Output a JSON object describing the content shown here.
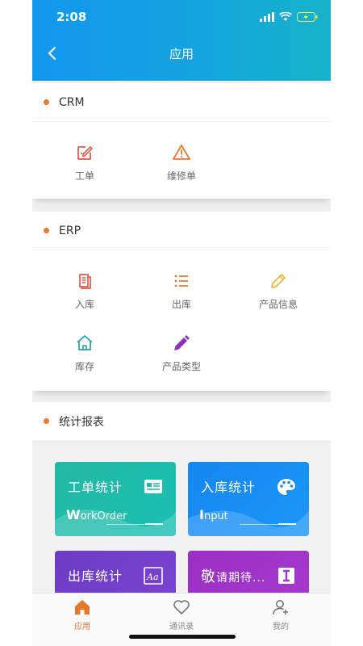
{
  "status": {
    "time": "2:08"
  },
  "header": {
    "title": "应用"
  },
  "sections": {
    "crm": {
      "title": "CRM",
      "items": [
        {
          "label": "工单"
        },
        {
          "label": "维修单"
        }
      ]
    },
    "erp": {
      "title": "ERP",
      "items": [
        {
          "label": "入库"
        },
        {
          "label": "出库"
        },
        {
          "label": "产品信息"
        },
        {
          "label": "库存"
        },
        {
          "label": "产品类型"
        }
      ]
    },
    "reports": {
      "title": "统计报表"
    }
  },
  "cards": [
    {
      "title": "工单统计",
      "sub_initial": "W",
      "sub_rest": "orkOrder"
    },
    {
      "title": "入库统计",
      "sub_initial": "I",
      "sub_rest": "nput"
    },
    {
      "title": "出库统计"
    },
    {
      "title_initial": "敬",
      "title_rest": "请期待..."
    }
  ],
  "tabs": [
    {
      "label": "应用"
    },
    {
      "label": "通讯录"
    },
    {
      "label": "我的"
    }
  ],
  "colors": {
    "accent": "#e87b2c",
    "header_start": "#1296ee",
    "header_end": "#17b3c8",
    "crm_icon": "#e25a4a",
    "warning_icon": "#e8772a"
  }
}
